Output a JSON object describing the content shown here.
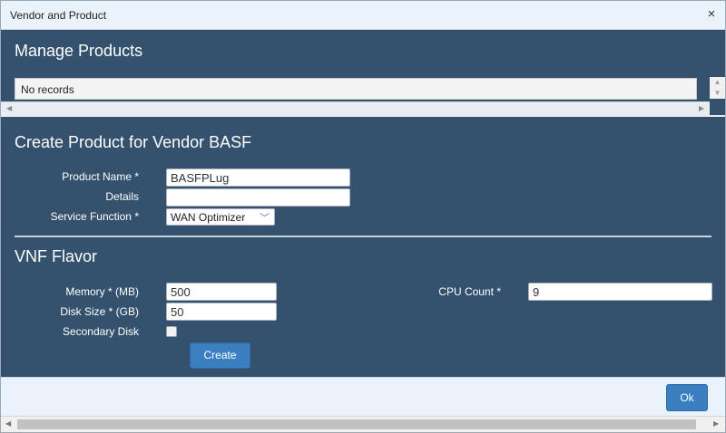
{
  "window": {
    "title": "Vendor and Product",
    "close_glyph": "×"
  },
  "manage": {
    "heading": "Manage Products",
    "grid_empty_text": "No records"
  },
  "create_product": {
    "heading": "Create Product for Vendor BASF",
    "product_name_label": "Product Name *",
    "product_name_value": "BASFPLug",
    "details_label": "Details",
    "details_value": "",
    "service_function_label": "Service Function *",
    "service_function_value": "WAN Optimizer"
  },
  "vnf_flavor": {
    "heading": "VNF Flavor",
    "memory_label": "Memory * (MB)",
    "memory_value": "500",
    "disk_label": "Disk Size * (GB)",
    "disk_value": "50",
    "secondary_disk_label": "Secondary Disk",
    "secondary_disk_checked": false,
    "cpu_label": "CPU Count *",
    "cpu_value": "9",
    "create_label": "Create"
  },
  "footer": {
    "ok_label": "Ok"
  },
  "icons": {
    "close": "close-icon",
    "chevron": "chevron-down-icon",
    "scroll_up": "scroll-up-icon",
    "scroll_down": "scroll-down-icon",
    "scroll_left": "scroll-left-icon",
    "scroll_right": "scroll-right-icon"
  },
  "colors": {
    "panel_bg": "#34526e",
    "button_bg": "#3c7fc0",
    "dialog_bg": "#eaf3fb"
  }
}
